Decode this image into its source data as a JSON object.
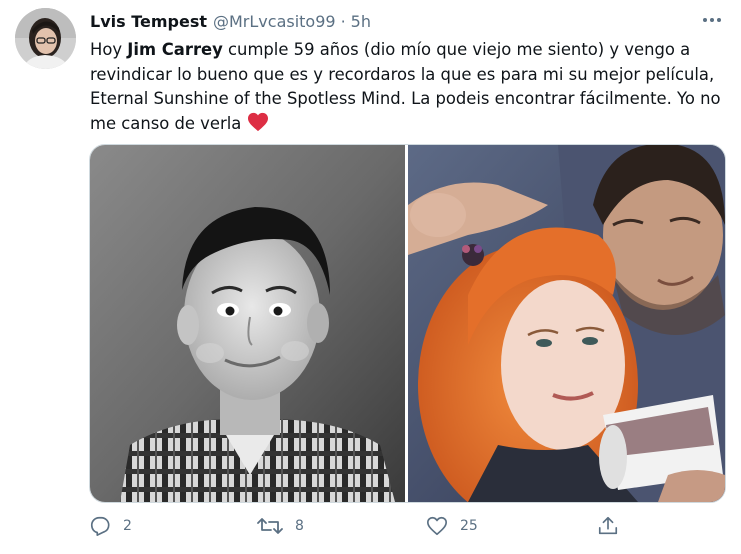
{
  "tweet": {
    "display_name": "Lvis Tempest",
    "handle": "@MrLvcasito99",
    "separator": "·",
    "time": "5h",
    "text_1": "Hoy ",
    "text_bold": "Jim Carrey",
    "text_2": " cumple 59 años (dio mío que viejo me siento) y vengo a revindicar lo bueno que es y recordaros la que es para mi su mejor película, Eternal Sunshine of the Spotless Mind. La podeis encontrar fácilmente. Yo no me canso de verla ",
    "emoji": "red-heart"
  },
  "actions": {
    "replies": "2",
    "retweets": "8",
    "likes": "25"
  },
  "icons": {
    "reply": "reply-icon",
    "retweet": "retweet-icon",
    "like": "heart-icon",
    "share": "share-icon",
    "more": "more-icon"
  },
  "colors": {
    "text": "#0f1419",
    "secondary": "#5b7083",
    "heart": "#e0245e",
    "border": "#cfd9de"
  }
}
